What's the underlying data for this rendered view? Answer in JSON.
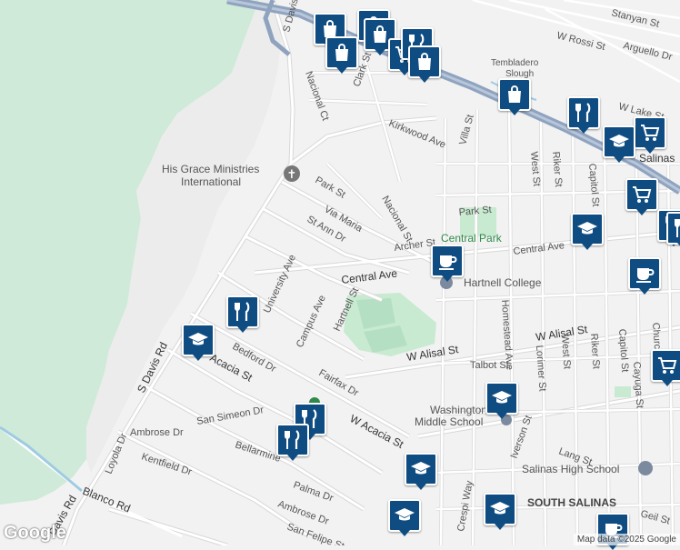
{
  "map": {
    "attribution": "Map data ©2025 Google",
    "logo": "Google",
    "colors": {
      "land": "#f2f2f2",
      "park": "#c8ead1",
      "road": "#ffffff",
      "highway": "#8fa3bf",
      "pin": "#0f4c81"
    },
    "labels": {
      "w_rossi": "W Rossi St",
      "stanyan": "Stanyan St",
      "arguello": "Arguello Dr",
      "tembladero": "Tembladero",
      "slough": "Slough",
      "w_lake": "W Lake St",
      "s_davis_top": "S Davis Rd",
      "nacional_ct": "Nacional Ct",
      "clark": "Clark St",
      "kirkwood": "Kirkwood Ave",
      "villa": "Villa St",
      "west_st": "West St",
      "riker_top": "Riker St",
      "capitol_top": "Capitol St",
      "salinas_edge": "Salinas",
      "hgm1": "His Grace Ministries",
      "hgm2": "International",
      "park_st": "Park St",
      "park_st2": "Park St",
      "via_maria": "Via Maria",
      "nacional_st": "Nacional St",
      "st_ann": "St Ann Dr",
      "archer": "Archer St",
      "central_park": "Central Park",
      "central_ave": "Central Ave",
      "central_ave2": "Central Ave",
      "hartnell_college": "Hartnell College",
      "university": "University Ave",
      "campus": "Campus Ave",
      "hartnell_st": "Hartnell St",
      "homestead": "Homestead Ave",
      "lorimer": "Lorimer St",
      "west_st2": "West St",
      "riker2": "Riker St",
      "capitol2": "Capitol St",
      "church": "Church",
      "w_alisal": "W Alisal St",
      "w_alisal2": "W Alisal St",
      "talbot": "Talbot St",
      "cayuga": "Cayuga St",
      "bedford": "Bedford Dr",
      "acacia": "Acacia St",
      "s_davis_left": "S Davis Rd",
      "fairfax": "Fairfax Dr",
      "washington1": "Washington",
      "washington2": "Middle School",
      "iverson": "Iverson St",
      "lang": "Lang St",
      "san_simeon": "San Simeon Dr",
      "w_acacia": "W Acacia St",
      "ambrose": "Ambrose Dr",
      "ambrose2": "Ambrose Dr",
      "loyola": "Loyola Dr",
      "kentfield": "Kentfield Dr",
      "bellarmine": "Bellarmine",
      "salinas_hs": "Salinas High School",
      "palma": "Palma Dr",
      "blanco": "Blanco Rd",
      "s_davis_bottom": "Davis Rd",
      "crespi": "Crespi Way",
      "south_salinas": "SOUTH SALINAS",
      "geil": "Geil St",
      "san_felipe": "San Felipe St"
    }
  },
  "pins": [
    {
      "id": "pin-shop-1",
      "icon": "shopping-bag-icon"
    },
    {
      "id": "pin-shop-2",
      "icon": "shopping-bag-icon"
    },
    {
      "id": "pin-shop-3",
      "icon": "shopping-bag-icon"
    },
    {
      "id": "pin-shop-4",
      "icon": "shopping-bag-icon"
    },
    {
      "id": "pin-cart-1",
      "icon": "shopping-cart-icon"
    },
    {
      "id": "pin-restaurant-1",
      "icon": "fork-knife-icon"
    },
    {
      "id": "pin-shop-5",
      "icon": "shopping-bag-icon"
    },
    {
      "id": "pin-shop-6",
      "icon": "shopping-bag-icon"
    },
    {
      "id": "pin-restaurant-2",
      "icon": "fork-knife-icon"
    },
    {
      "id": "pin-cart-2",
      "icon": "shopping-cart-icon"
    },
    {
      "id": "pin-school-1",
      "icon": "graduation-cap-icon"
    },
    {
      "id": "pin-cart-3",
      "icon": "shopping-cart-icon"
    },
    {
      "id": "pin-school-2",
      "icon": "graduation-cap-icon"
    },
    {
      "id": "pin-restaurant-3",
      "icon": "fork-knife-icon"
    },
    {
      "id": "pin-cafe-1",
      "icon": "coffee-cup-icon"
    },
    {
      "id": "pin-cafe-2",
      "icon": "coffee-cup-icon"
    },
    {
      "id": "pin-restaurant-4",
      "icon": "fork-knife-icon"
    },
    {
      "id": "pin-school-3",
      "icon": "graduation-cap-icon"
    },
    {
      "id": "pin-cart-4",
      "icon": "shopping-cart-icon"
    },
    {
      "id": "pin-school-4",
      "icon": "graduation-cap-icon"
    },
    {
      "id": "pin-restaurant-5",
      "icon": "fork-knife-icon"
    },
    {
      "id": "pin-restaurant-6",
      "icon": "fork-knife-icon"
    },
    {
      "id": "pin-school-5",
      "icon": "graduation-cap-icon"
    },
    {
      "id": "pin-school-6",
      "icon": "graduation-cap-icon"
    },
    {
      "id": "pin-school-7",
      "icon": "graduation-cap-icon"
    },
    {
      "id": "pin-cafe-3",
      "icon": "coffee-cup-icon"
    },
    {
      "id": "pin-restaurant-7",
      "icon": "fork-knife-icon"
    }
  ]
}
